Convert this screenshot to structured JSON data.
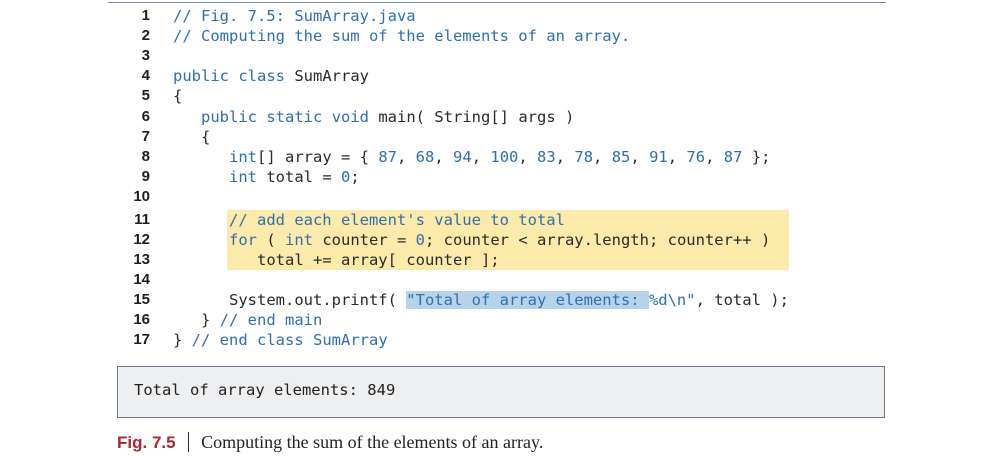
{
  "code": {
    "lines": [
      {
        "num": "1",
        "text": "// Fig. 7.5: SumArray.java"
      },
      {
        "num": "2",
        "text": "// Computing the sum of the elements of an array."
      },
      {
        "num": "3",
        "text": ""
      },
      {
        "num": "4",
        "text": "public class SumArray"
      },
      {
        "num": "5",
        "text": "{"
      },
      {
        "num": "6",
        "text": "   public static void main( String[] args )"
      },
      {
        "num": "7",
        "text": "   {"
      },
      {
        "num": "8",
        "text": "      int[] array = { 87, 68, 94, 100, 83, 78, 85, 91, 76, 87 };"
      },
      {
        "num": "9",
        "text": "      int total = 0;"
      },
      {
        "num": "10",
        "text": ""
      },
      {
        "num": "11",
        "text": "      // add each element's value to total"
      },
      {
        "num": "12",
        "text": "      for ( int counter = 0; counter < array.length; counter++ )"
      },
      {
        "num": "13",
        "text": "         total += array[ counter ];"
      },
      {
        "num": "14",
        "text": ""
      },
      {
        "num": "15",
        "text": "      System.out.printf( \"Total of array elements: %d\\n\", total );"
      },
      {
        "num": "16",
        "text": "   } // end main"
      },
      {
        "num": "17",
        "text": "} // end class SumArray"
      }
    ]
  },
  "output": {
    "text": "Total of array elements: 849"
  },
  "caption": {
    "label": "Fig. 7.5",
    "text": "Computing the sum of the elements of an array."
  },
  "colors": {
    "keyword": "#2f6fb0",
    "highlight": "#fbeaa9",
    "selection": "#b7d3ea",
    "fig_label": "#b0232f"
  }
}
